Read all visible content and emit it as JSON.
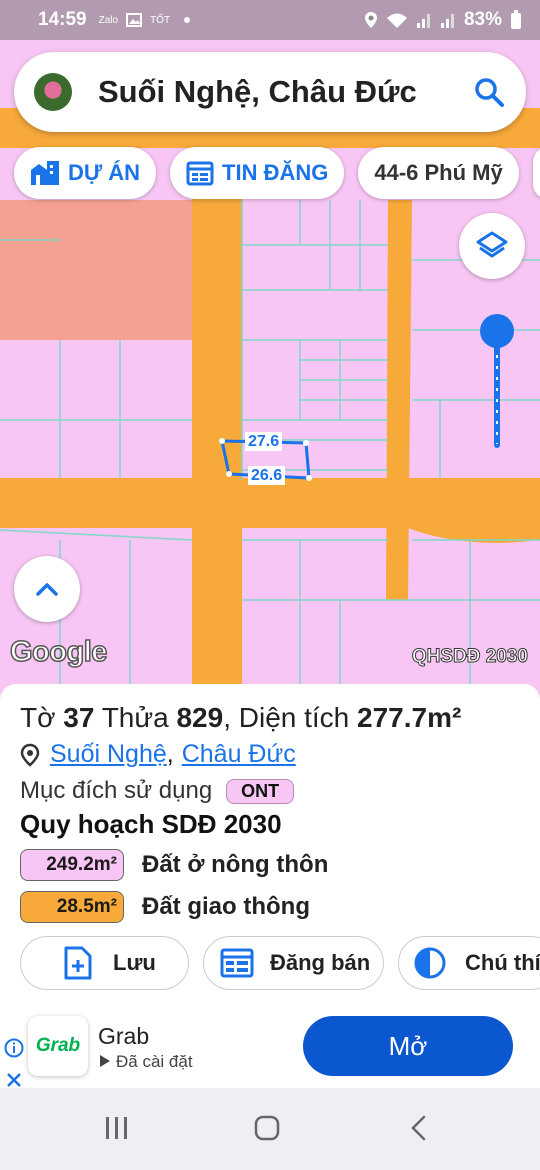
{
  "status_bar": {
    "time": "14:59",
    "mini_icons": [
      "Zalo",
      "TỐT"
    ],
    "battery": "83%"
  },
  "search": {
    "title": "Suối Nghệ, Châu Đức"
  },
  "chips": [
    {
      "label": "DỰ ÁN"
    },
    {
      "label": "TIN ĐĂNG"
    },
    {
      "label": "44-6 Phú Mỹ"
    }
  ],
  "map": {
    "plot_dims": {
      "top": "27.6",
      "bottom": "26.6"
    },
    "google_label": "Google",
    "layer_label": "QHSDĐ 2030",
    "colors": {
      "residential": "#f8c6f4",
      "road": "#f7a93a",
      "public": "#f4a191",
      "boundary": "#7fd8c8"
    }
  },
  "parcel": {
    "sheet_prefix": "Tờ",
    "sheet_no": "37",
    "lot_prefix": "Thửa",
    "lot_no": "829",
    "area_prefix": ", Diện tích",
    "area": "277.7m²",
    "commune": "Suối Nghệ",
    "separator": ",",
    "district": "Châu Đức",
    "purpose_label": "Mục đích sử dụng",
    "purpose_code": "ONT",
    "plan_title": "Quy hoạch SDĐ 2030",
    "land_uses": [
      {
        "area": "249.2m²",
        "label": "Đất ở nông thôn",
        "color": "#f8c6f4"
      },
      {
        "area": "28.5m²",
        "label": "Đất giao thông",
        "color": "#f7a93a"
      }
    ]
  },
  "actions": [
    {
      "label": "Lưu",
      "icon": "add-file-icon"
    },
    {
      "label": "Đăng bán",
      "icon": "listing-icon"
    },
    {
      "label": "Chú thí",
      "icon": "contrast-icon"
    }
  ],
  "ad": {
    "logo_text": "Grab",
    "name": "Grab",
    "sub": "Đã cài đặt",
    "button": "Mở"
  }
}
